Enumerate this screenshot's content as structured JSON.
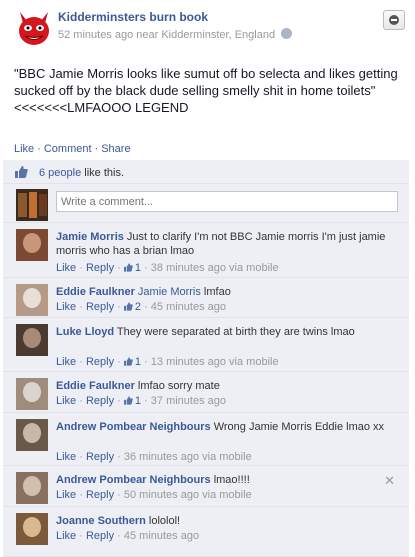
{
  "post": {
    "page_name": "Kidderminsters burn book",
    "meta": "52 minutes ago near Kidderminster, England",
    "message": "\"BBC Jamie Morris looks like sumut off bo selecta and likes getting sucked off by the black dude selling smelly shit in home toilets\" <<<<<<<LMFAOOO LEGEND",
    "actions": {
      "like": "Like",
      "comment": "Comment",
      "share": "Share",
      "sep": "·"
    }
  },
  "likes": {
    "count_link": "6 people",
    "suffix": " like this."
  },
  "composer": {
    "placeholder": "Write a comment..."
  },
  "comments": [
    {
      "author": "Jamie Morris",
      "text": " Just to clarify I'm not BBC Jamie morris I'm just jamie morris who has a brian lmao",
      "like": "Like",
      "reply": "Reply",
      "likes": "1",
      "time": " · 38 minutes ago via mobile"
    },
    {
      "author": "Eddie Faulkner",
      "tag": "Jamie Morris",
      "text": " lmfao",
      "like": "Like",
      "reply": "Reply",
      "likes": "2",
      "time": " · 45 minutes ago"
    },
    {
      "author": "Luke Lloyd",
      "text": " They were separated at birth they are twins lmao",
      "like": "Like",
      "reply": "Reply",
      "likes": "1",
      "time": " · 13 minutes ago via mobile"
    },
    {
      "author": "Eddie Faulkner",
      "text": " lmfao sorry mate",
      "like": "Like",
      "reply": "Reply",
      "likes": "1",
      "time": " · 37 minutes ago"
    },
    {
      "author": "Andrew Pombear Neighbours",
      "text": " Wrong Jamie Morris Eddie lmao xx",
      "like": "Like",
      "reply": "Reply",
      "time": " · 36 minutes ago via mobile"
    },
    {
      "author": "Andrew Pombear Neighbours",
      "text": " lmao!!!!",
      "like": "Like",
      "reply": "Reply",
      "time": " · 50 minutes ago via mobile"
    },
    {
      "author": "Joanne Southern",
      "text": " lololol!",
      "like": "Like",
      "reply": "Reply",
      "time": " · 45 minutes ago"
    }
  ],
  "ui": {
    "sep": " · "
  },
  "colors": {
    "link": "#3b5998",
    "feedback_bg": "#edeff4",
    "meta": "#999999"
  }
}
